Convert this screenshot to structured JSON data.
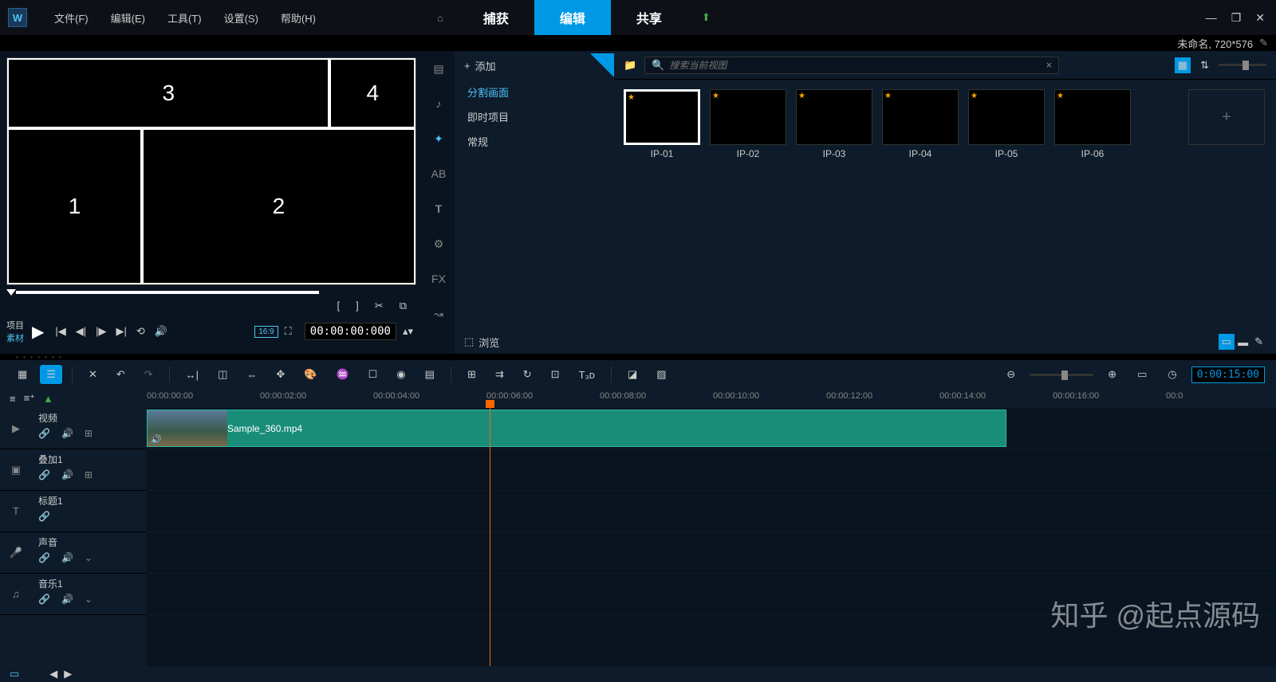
{
  "menubar": {
    "items": [
      "文件(F)",
      "编辑(E)",
      "工具(T)",
      "设置(S)",
      "帮助(H)"
    ],
    "tabs": {
      "home": "⌂",
      "capture": "捕获",
      "edit": "编辑",
      "share": "共享"
    },
    "project_info": "未命名, 720*576"
  },
  "preview": {
    "quadrants": [
      "1",
      "2",
      "3",
      "4"
    ],
    "labels": {
      "project": "项目",
      "material": "素材"
    },
    "aspect": "16:9",
    "timecode": "00:00:00:000"
  },
  "library": {
    "add": "添加",
    "categories": [
      "分割画面",
      "即时项目",
      "常规"
    ],
    "search_placeholder": "搜索当前视图",
    "thumbs": [
      "IP-01",
      "IP-02",
      "IP-03",
      "IP-04",
      "IP-05",
      "IP-06"
    ],
    "browse": "浏览",
    "sidetabs": {
      "fx": "FX"
    }
  },
  "timeline": {
    "ruler": [
      "00:00:00:00",
      "00:00:02:00",
      "00:00:04:00",
      "00:00:06:00",
      "00:00:08:00",
      "00:00:10:00",
      "00:00:12:00",
      "00:00:14:00",
      "00:00:16:00",
      "00:0"
    ],
    "timecode": "0:00:15:00",
    "tracks": {
      "video": "视频",
      "overlay": "叠加1",
      "title": "标题1",
      "audio": "声音",
      "music": "音乐1"
    },
    "clip_name": "Sample_360.mp4"
  },
  "watermark": "知乎 @起点源码"
}
